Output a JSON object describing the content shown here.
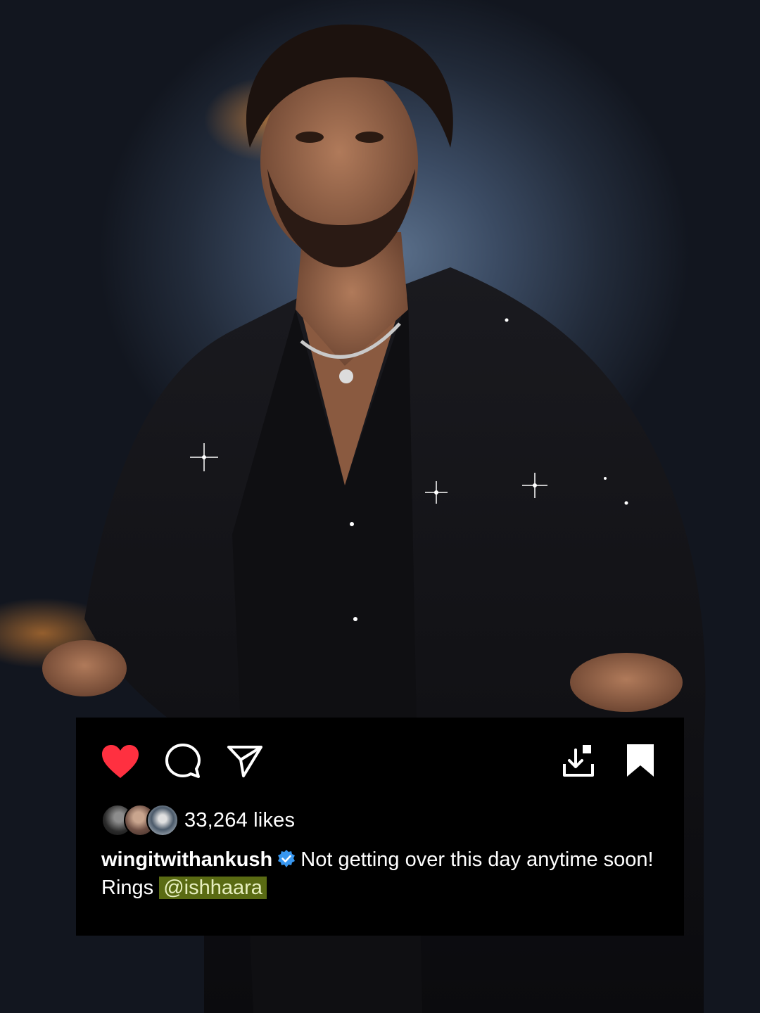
{
  "post": {
    "likes_text": "33,264 likes",
    "username": "wingitwithankush",
    "caption_line1": "Not getting over this day anytime soon!",
    "caption_line2_prefix": "Rings",
    "mention": "@ishhaara"
  },
  "icons": {
    "like": "heart-icon",
    "comment": "comment-icon",
    "share": "send-icon",
    "download": "download-icon",
    "save": "bookmark-icon",
    "verified": "verified-badge-icon"
  },
  "colors": {
    "heart": "#ff3040",
    "verified": "#3897f0",
    "mention_highlight": "#5a6b13",
    "card_background": "#000000"
  }
}
